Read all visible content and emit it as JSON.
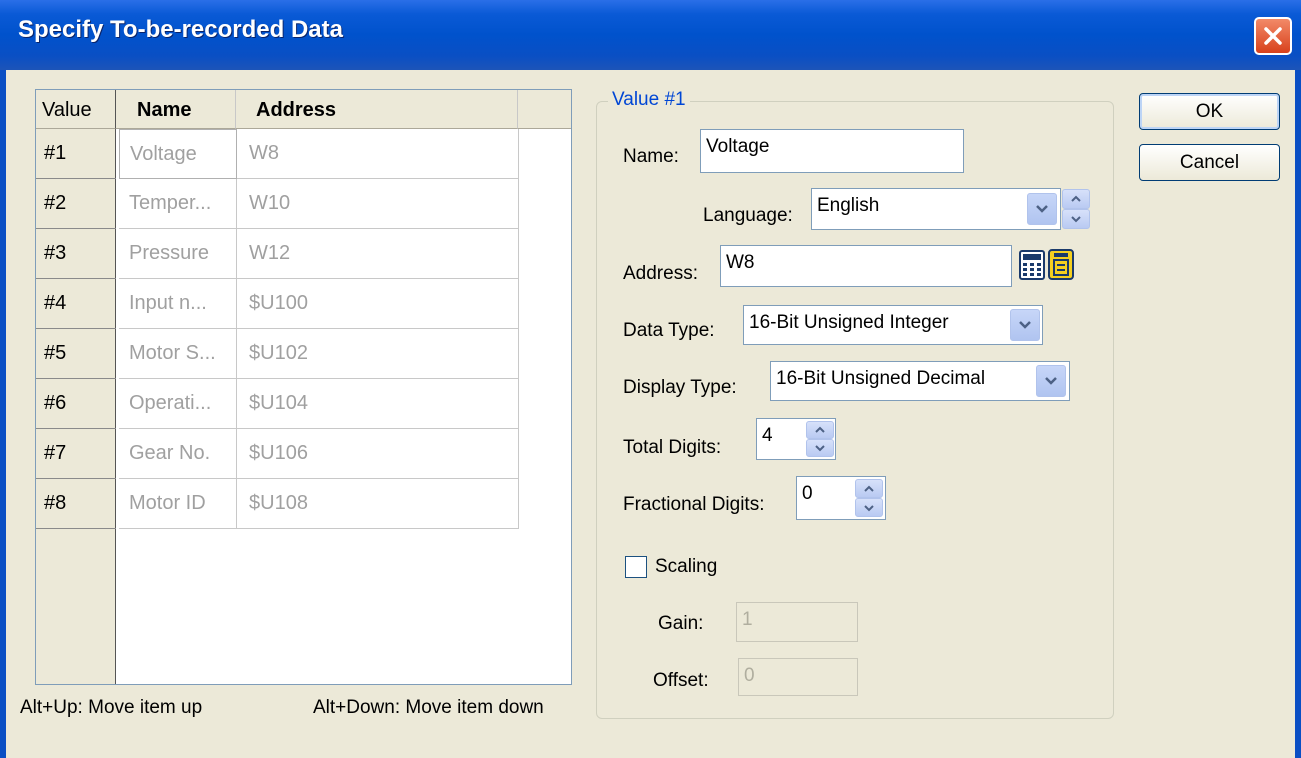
{
  "window": {
    "title": "Specify To-be-recorded Data"
  },
  "list": {
    "headers": {
      "value": "Value",
      "name": "Name",
      "address": "Address"
    },
    "rows": [
      {
        "num": "#1",
        "name": "Voltage",
        "address": "W8"
      },
      {
        "num": "#2",
        "name": "Temper...",
        "address": "W10"
      },
      {
        "num": "#3",
        "name": "Pressure",
        "address": "W12"
      },
      {
        "num": "#4",
        "name": "Input n...",
        "address": "$U100"
      },
      {
        "num": "#5",
        "name": "Motor S...",
        "address": "$U102"
      },
      {
        "num": "#6",
        "name": "Operati...",
        "address": "$U104"
      },
      {
        "num": "#7",
        "name": "Gear No.",
        "address": "$U106"
      },
      {
        "num": "#8",
        "name": "Motor ID",
        "address": "$U108"
      }
    ],
    "hint_up": "Alt+Up: Move item up",
    "hint_down": "Alt+Down: Move item down"
  },
  "group": {
    "title": "Value #1",
    "name_label": "Name:",
    "name_value": "Voltage",
    "language_label": "Language:",
    "language_value": "English",
    "address_label": "Address:",
    "address_value": "W8",
    "data_type_label": "Data Type:",
    "data_type_value": "16-Bit Unsigned Integer",
    "display_type_label": "Display Type:",
    "display_type_value": "16-Bit Unsigned Decimal",
    "total_digits_label": "Total Digits:",
    "total_digits_value": "4",
    "fractional_digits_label": "Fractional Digits:",
    "fractional_digits_value": "0",
    "scaling_label": "Scaling",
    "scaling_checked": false,
    "gain_label": "Gain:",
    "gain_value": "1",
    "offset_label": "Offset:",
    "offset_value": "0"
  },
  "buttons": {
    "ok": "OK",
    "cancel": "Cancel"
  },
  "icons": {
    "close": "close-icon",
    "calculator": "calculator-icon",
    "tag_browse": "tag-browse-icon"
  },
  "colors": {
    "titlebar": "#0052cc",
    "dialog_bg": "#ece9d8",
    "group_title": "#0046d5",
    "close": "#d8411c"
  }
}
